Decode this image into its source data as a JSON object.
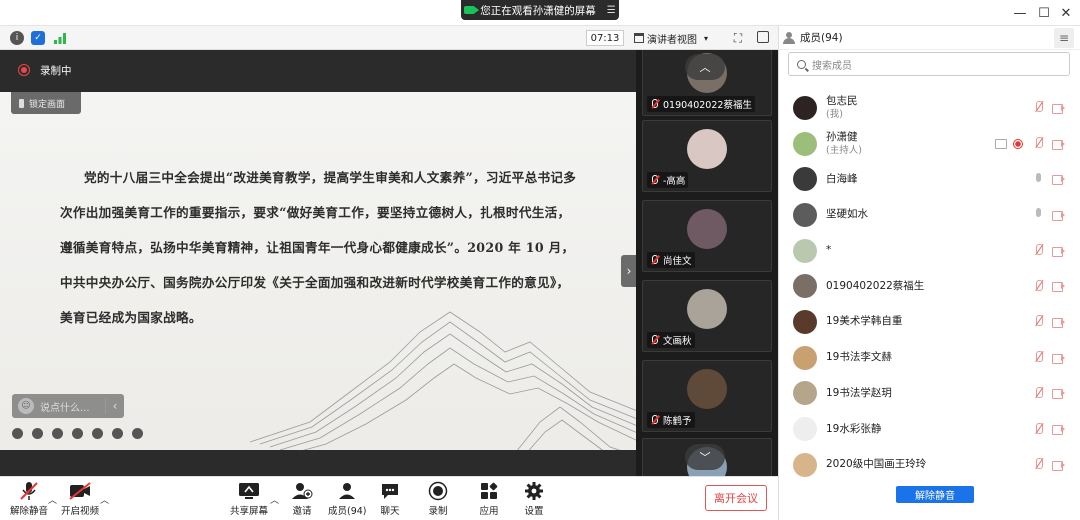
{
  "titlebar": {
    "share_notice": "您正在观看孙潇健的屏幕"
  },
  "toolbar": {
    "timer": "07:13",
    "view_mode": "演讲者视图"
  },
  "stage": {
    "recording_label": "录制中",
    "lock_view": "锁定画面",
    "slide_text": "党的十八届三中全会提出“改进美育教学，提高学生审美和人文素养”，习近平总书记多次作出加强美育工作的重要指示，要求“做好美育工作，要坚持立德树人，扎根时代生活，遵循美育特点，弘扬中华美育精神，让祖国青年一代身心都健康成长”。2020 年 10 月，中共中央办公厅、国务院办公厅印发《关于全面加强和改进新时代学校美育工作的意见》，美育已经成为国家战略。",
    "chat_placeholder": "说点什么..."
  },
  "strip": {
    "tiles": [
      {
        "name": "0190402022蔡福生",
        "color": "#7a6f66"
      },
      {
        "name": "-高高",
        "color": "#d9c7c3"
      },
      {
        "name": "尚佳文",
        "color": "#6f5a64"
      },
      {
        "name": "文画秋",
        "color": "#a9a39a"
      },
      {
        "name": "陈鹤予",
        "color": "#5f4a3a"
      },
      {
        "name": "",
        "color": "#8aa0b5"
      }
    ]
  },
  "bottombar": {
    "unmute": "解除静音",
    "start_video": "开启视频",
    "share_screen": "共享屏幕",
    "invite": "邀请",
    "members": "成员(94)",
    "chat": "聊天",
    "record": "录制",
    "apps": "应用",
    "settings": "设置",
    "leave": "离开会议"
  },
  "panel": {
    "title": "成员(94)",
    "search_placeholder": "搜索成员",
    "unmute_all": "解除静音",
    "members": [
      {
        "name": "包志民",
        "sub": "(我)",
        "color": "#2e2323",
        "mic": "muted"
      },
      {
        "name": "孙潇健",
        "sub": "(主持人)",
        "color": "#9bbf7a",
        "mic": "muted",
        "host": true
      },
      {
        "name": "白海峰",
        "sub": "",
        "color": "#3a3a3a",
        "mic": "on"
      },
      {
        "name": "坚硬如水",
        "sub": "",
        "color": "#5c5c5c",
        "mic": "on"
      },
      {
        "name": "*",
        "sub": "",
        "color": "#b8c9b0",
        "mic": "muted"
      },
      {
        "name": "0190402022蔡福生",
        "sub": "",
        "color": "#7a6f66",
        "mic": "muted"
      },
      {
        "name": "19美术学韩自重",
        "sub": "",
        "color": "#5a3a2a",
        "mic": "muted"
      },
      {
        "name": "19书法李文赫",
        "sub": "",
        "color": "#c9a070",
        "mic": "muted"
      },
      {
        "name": "19书法学赵玥",
        "sub": "",
        "color": "#b5a58a",
        "mic": "muted"
      },
      {
        "name": "19水彩张静",
        "sub": "",
        "color": "#eeeeee",
        "mic": "muted"
      },
      {
        "name": "2020级中国画王玲玲",
        "sub": "",
        "color": "#d8b48a",
        "mic": "muted"
      }
    ]
  }
}
